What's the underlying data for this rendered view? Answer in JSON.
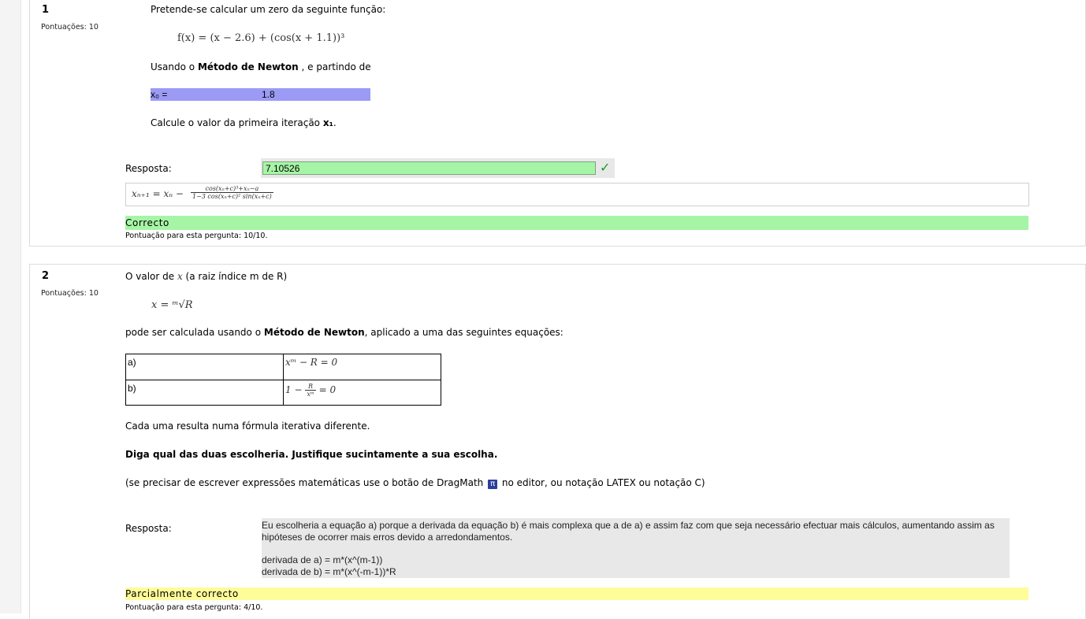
{
  "q1": {
    "number": "1",
    "grade": "Pontuações: 10",
    "intro": "Pretende-se calcular um zero da seguinte função:",
    "formula": "f(x) = (x − 2.6) + (cos(x + 1.1))³",
    "method_pre": "Usando o ",
    "method_bold": "Método de Newton",
    "method_post": " , e partindo de",
    "x0_label": "x₀ =",
    "x0_value": "1.8",
    "ask_pre": "Calcule o valor da primeira iteração ",
    "ask_bold": "x₁",
    "ask_post": ".",
    "answer_label": "Resposta:",
    "answer_value": "7.10526",
    "feedback_lhs": "xₙ₊₁ = xₙ −",
    "feedback_num": "cos(xₙ+c)³+xₙ−a",
    "feedback_den": "1−3 cos(xₙ+c)² sin(xₙ+c)",
    "state": "Correcto",
    "mark": "Pontuação para esta pergunta: 10/10."
  },
  "q2": {
    "number": "2",
    "grade": "Pontuações: 10",
    "intro_pre": "O valor de ",
    "intro_var": "x",
    "intro_post": " (a raiz índice m de R)",
    "formula": "x = ᵐ√R",
    "text1_pre": "pode ser calculada usando o ",
    "text1_bold": "Método de Newton",
    "text1_post": ", aplicado a uma das seguintes equações:",
    "table": [
      {
        "label": "a)",
        "eq": "xᵐ − R = 0"
      },
      {
        "label": "b)",
        "eq_pre": "1 −",
        "eq_num": "R",
        "eq_den": "xᵐ",
        "eq_post": "= 0"
      }
    ],
    "text2": "Cada uma resulta numa fórmula iterativa diferente.",
    "text3": "Diga qual das duas escolheria. Justifique sucintamente a sua escolha.",
    "text4_pre": "(se precisar de escrever expressões matemáticas use o botão de DragMath",
    "text4_icon": "π",
    "text4_post": "no editor, ou notação LATEX ou notação C)",
    "answer_label": "Resposta:",
    "answer_lines": [
      "Eu escolheria a equação a) porque a derivada da equação b) é mais complexa que a de a) e assim faz com que seja necessário efectuar mais cálculos, aumentando assim as hipóteses de ocorrer mais erros devido a arredondamentos.",
      "derivada de a) = m*(x^(m-1))",
      "derivada de b) = m*(x^(-m-1))*R"
    ],
    "state": "Parcialmente correcto",
    "mark": "Pontuação para esta pergunta: 4/10."
  },
  "colors": {
    "correct": "#a6f5a6",
    "partial": "#fdfd9a",
    "highlight": "#9b9bf6",
    "check": "#1a9a1a"
  }
}
